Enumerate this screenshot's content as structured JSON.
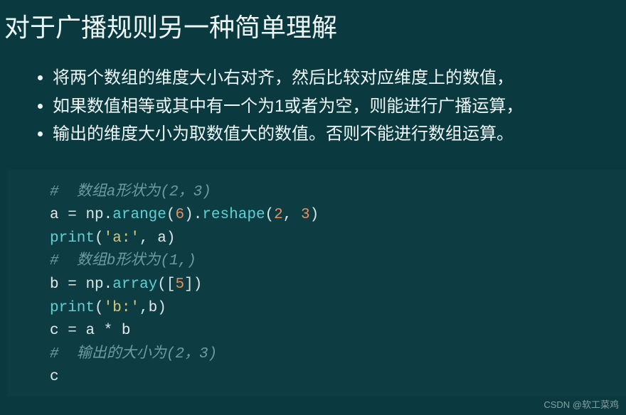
{
  "title": "对于广播规则另一种简单理解",
  "bullets": [
    "将两个数组的维度大小右对齐，然后比较对应维度上的数值，",
    "如果数值相等或其中有一个为1或者为空，则能进行广播运算，",
    "输出的维度大小为取数值大的数值。否则不能进行数组运算。"
  ],
  "code": {
    "lines": [
      {
        "type": "comment",
        "tokens": [
          {
            "t": "#  数组a形状为(2，3)",
            "c": "comment"
          }
        ]
      },
      {
        "type": "code",
        "tokens": [
          {
            "t": "a ",
            "c": "var"
          },
          {
            "t": "= ",
            "c": "op"
          },
          {
            "t": "np",
            "c": "ns"
          },
          {
            "t": ".",
            "c": "punct"
          },
          {
            "t": "arange",
            "c": "func"
          },
          {
            "t": "(",
            "c": "punct"
          },
          {
            "t": "6",
            "c": "num"
          },
          {
            "t": ")",
            "c": "punct"
          },
          {
            "t": ".",
            "c": "punct"
          },
          {
            "t": "reshape",
            "c": "func"
          },
          {
            "t": "(",
            "c": "punct"
          },
          {
            "t": "2",
            "c": "num"
          },
          {
            "t": ", ",
            "c": "punct"
          },
          {
            "t": "3",
            "c": "num"
          },
          {
            "t": ")",
            "c": "punct"
          }
        ]
      },
      {
        "type": "code",
        "tokens": [
          {
            "t": "print",
            "c": "func"
          },
          {
            "t": "(",
            "c": "punct"
          },
          {
            "t": "'a:'",
            "c": "str"
          },
          {
            "t": ", ",
            "c": "punct"
          },
          {
            "t": "a",
            "c": "var"
          },
          {
            "t": ")",
            "c": "punct"
          }
        ]
      },
      {
        "type": "comment",
        "tokens": [
          {
            "t": "#  数组b形状为(1,)",
            "c": "comment"
          }
        ]
      },
      {
        "type": "code",
        "tokens": [
          {
            "t": "b ",
            "c": "var"
          },
          {
            "t": "= ",
            "c": "op"
          },
          {
            "t": "np",
            "c": "ns"
          },
          {
            "t": ".",
            "c": "punct"
          },
          {
            "t": "array",
            "c": "func"
          },
          {
            "t": "([",
            "c": "punct"
          },
          {
            "t": "5",
            "c": "num"
          },
          {
            "t": "])",
            "c": "punct"
          }
        ]
      },
      {
        "type": "code",
        "tokens": [
          {
            "t": "print",
            "c": "func"
          },
          {
            "t": "(",
            "c": "punct"
          },
          {
            "t": "'b:'",
            "c": "str"
          },
          {
            "t": ",",
            "c": "punct"
          },
          {
            "t": "b",
            "c": "var"
          },
          {
            "t": ")",
            "c": "punct"
          }
        ]
      },
      {
        "type": "code",
        "tokens": [
          {
            "t": "c ",
            "c": "var"
          },
          {
            "t": "= ",
            "c": "op"
          },
          {
            "t": "a ",
            "c": "var"
          },
          {
            "t": "* ",
            "c": "op"
          },
          {
            "t": "b",
            "c": "var"
          }
        ]
      },
      {
        "type": "comment",
        "tokens": [
          {
            "t": "#  输出的大小为(2，3)",
            "c": "comment"
          }
        ]
      },
      {
        "type": "code",
        "tokens": [
          {
            "t": "c",
            "c": "var"
          }
        ]
      }
    ]
  },
  "watermark": "CSDN @软工菜鸡"
}
